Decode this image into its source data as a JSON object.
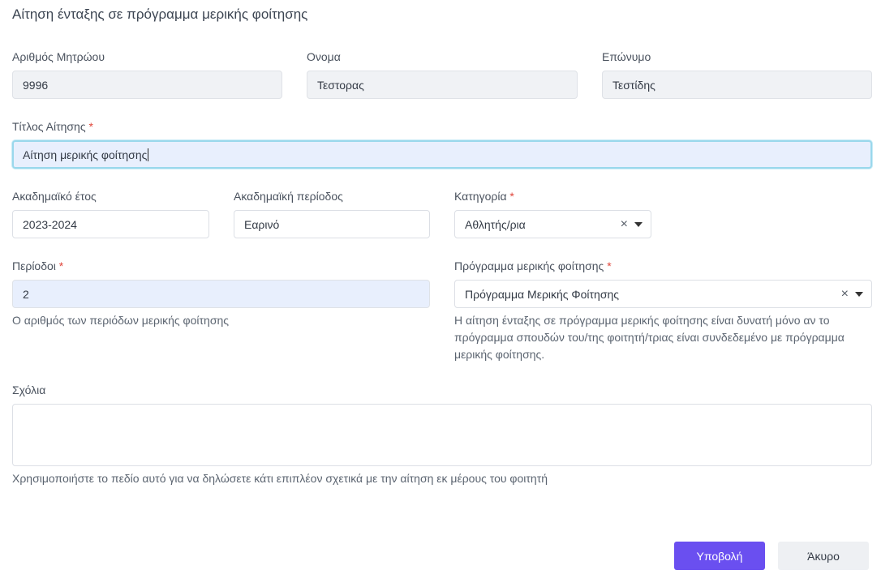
{
  "page": {
    "title": "Αίτηση ένταξης σε πρόγραμμα μερικής φοίτησης"
  },
  "student": {
    "registry_label": "Αριθμός Μητρώου",
    "registry_value": "9996",
    "first_name_label": "Ονομα",
    "first_name_value": "Τεστορας",
    "last_name_label": "Επώνυμο",
    "last_name_value": "Τεστίδης"
  },
  "request_title": {
    "label": "Τίτλος Αίτησης",
    "required_mark": "*",
    "value": "Αίτηση μερικής φοίτησης"
  },
  "academic_year": {
    "label": "Ακαδημαϊκό έτος",
    "value": "2023-2024"
  },
  "academic_period": {
    "label": "Ακαδημαϊκή περίοδος",
    "value": "Εαρινό"
  },
  "category": {
    "label": "Κατηγορία",
    "required_mark": "*",
    "value": "Αθλητής/ρια",
    "clear_symbol": "×",
    "icon": "chevron-down-icon"
  },
  "periods": {
    "label": "Περίοδοι",
    "required_mark": "*",
    "value": "2",
    "help": "Ο αριθμός των περιόδων μερικής φοίτησης"
  },
  "program": {
    "label": "Πρόγραμμα μερικής φοίτησης",
    "required_mark": "*",
    "value": "Πρόγραμμα Μερικής Φοίτησης",
    "clear_symbol": "×",
    "icon": "chevron-down-icon",
    "help_line1": "Η αίτηση ένταξης σε πρόγραμμα μερικής φοίτησης είναι δυνατή μόνο αν το",
    "help_line2": "πρόγραμμα σπουδών του/της φοιτητή/τριας είναι συνδεδεμένο με πρόγραμμα",
    "help_line3": "μερικής φοίτησης."
  },
  "comments": {
    "label": "Σχόλια",
    "value": "",
    "help": "Χρησιμοποιήστε το πεδίο αυτό για να δηλώσετε κάτι επιπλέον σχετικά με την αίτηση εκ μέρους του φοιτητή"
  },
  "actions": {
    "submit_label": "Υποβολή",
    "cancel_label": "Άκυρο"
  },
  "colors": {
    "primary": "#6a4ff0",
    "required": "#e0463b",
    "focus_border": "#9ad8ec",
    "filled_bg": "#e8effd"
  }
}
